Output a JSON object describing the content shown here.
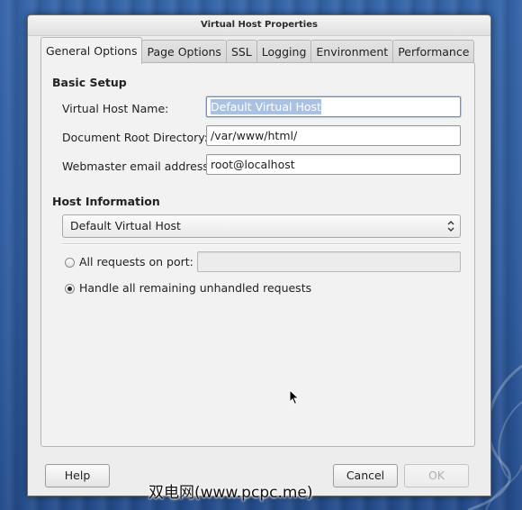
{
  "window": {
    "title": "Virtual Host Properties"
  },
  "tabs": [
    {
      "label": "General Options",
      "active": true
    },
    {
      "label": "Page Options",
      "active": false
    },
    {
      "label": "SSL",
      "active": false
    },
    {
      "label": "Logging",
      "active": false
    },
    {
      "label": "Environment",
      "active": false
    },
    {
      "label": "Performance",
      "active": false
    }
  ],
  "basic_setup": {
    "title": "Basic Setup",
    "virtual_host_name": {
      "label": "Virtual Host Name:",
      "value": "Default Virtual Host"
    },
    "document_root": {
      "label": "Document Root Directory:",
      "value": "/var/www/html/"
    },
    "webmaster_email": {
      "label": "Webmaster email address:",
      "value": "root@localhost"
    }
  },
  "host_information": {
    "title": "Host Information",
    "host_type": {
      "selected": "Default Virtual Host"
    },
    "all_requests_on_port": {
      "label": "All requests on port:",
      "checked": false,
      "port_value": ""
    },
    "handle_remaining": {
      "label": "Handle all remaining unhandled requests",
      "checked": true
    }
  },
  "buttons": {
    "help": "Help",
    "cancel": "Cancel",
    "ok": "OK"
  },
  "watermark": "双电网(www.pcpc.me)",
  "icons": {
    "combo_arrow": "updown-chevron-icon",
    "cursor": "mouse-pointer-icon"
  },
  "colors": {
    "desktop_background": "#2f5c9f",
    "selection": "#a9c2e3",
    "window_background": "#ededed"
  }
}
